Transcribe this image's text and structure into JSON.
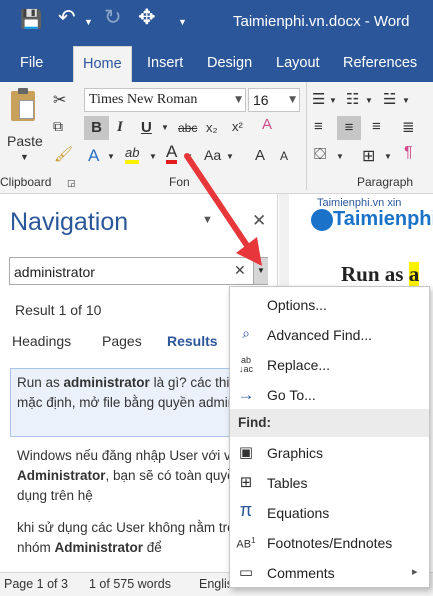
{
  "titlebar": {
    "document_title": "Taimienphi.vn.docx - Word",
    "save_glyph": "💾",
    "undo_glyph": "↶",
    "redo_glyph": "↻",
    "customize_glyph": "✥"
  },
  "tabs": [
    {
      "label": "File"
    },
    {
      "label": "Home"
    },
    {
      "label": "Insert"
    },
    {
      "label": "Design"
    },
    {
      "label": "Layout"
    },
    {
      "label": "References"
    }
  ],
  "ribbon": {
    "paste_label": "Paste",
    "font_name": "Times New Roman",
    "font_size": "16",
    "clipboard_label": "Clipboard",
    "font_group_label": "Fon",
    "paragraph_label": "Paragraph",
    "glyphs": {
      "bold": "B",
      "italic": "I",
      "underline": "U",
      "strike": "abc",
      "subscript": "x₂",
      "superscript": "x²",
      "text_effects": "A",
      "highlight": "ab",
      "font_color": "A",
      "change_case": "Aa",
      "grow": "A",
      "shrink": "A",
      "clear_format": "A"
    }
  },
  "navigation": {
    "title": "Navigation",
    "search_value": "administrator",
    "clear_glyph": "✕",
    "result_count": "Result 1 of 10",
    "tabs": [
      {
        "label": "Headings"
      },
      {
        "label": "Pages"
      },
      {
        "label": "Results"
      }
    ],
    "results": [
      {
        "pre": "Run as ",
        "bold": "administrator",
        "post": " là gì? các thiết lập mặc định, mở file bằng quyền admin"
      },
      {
        "pre": "Windows nếu đăng nhập User với vai trò ",
        "bold": "Administrator",
        "post": ", bạn sẽ có toàn quyền sử dụng trên hệ"
      },
      {
        "pre": "khi sử dụng các User không nằm trong nhóm ",
        "bold": "Administrator",
        "post": " để"
      }
    ]
  },
  "document": {
    "logo_text": "Taimienphi",
    "logo_sub": "Taimienphi.vn xin",
    "heading_fragment": "Run as ",
    "heading_highlight": "a"
  },
  "search_options_menu": {
    "items": [
      {
        "label": "Options...",
        "icon": ""
      },
      {
        "label": "Advanced Find...",
        "icon": "🔍"
      },
      {
        "label": "Replace...",
        "icon": "ab↓ac"
      },
      {
        "label": "Go To...",
        "icon": "→"
      }
    ],
    "find_header": "Find:",
    "find_items": [
      {
        "label": "Graphics",
        "icon": "▣"
      },
      {
        "label": "Tables",
        "icon": "⊞"
      },
      {
        "label": "Equations",
        "icon": "π"
      },
      {
        "label": "Footnotes/Endnotes",
        "icon": "AB¹"
      },
      {
        "label": "Comments",
        "icon": "▭"
      }
    ],
    "submenu_arrow": "▸"
  },
  "status": {
    "page": "Page 1 of 3",
    "words": "1 of 575 words",
    "language": "Englis"
  },
  "colors": {
    "word_blue": "#2b579a",
    "highlight_yellow": "#fff200",
    "font_red": "#e21b1b",
    "arrow_red": "#e8373a",
    "result_selected_bg": "#eaf1fb"
  }
}
